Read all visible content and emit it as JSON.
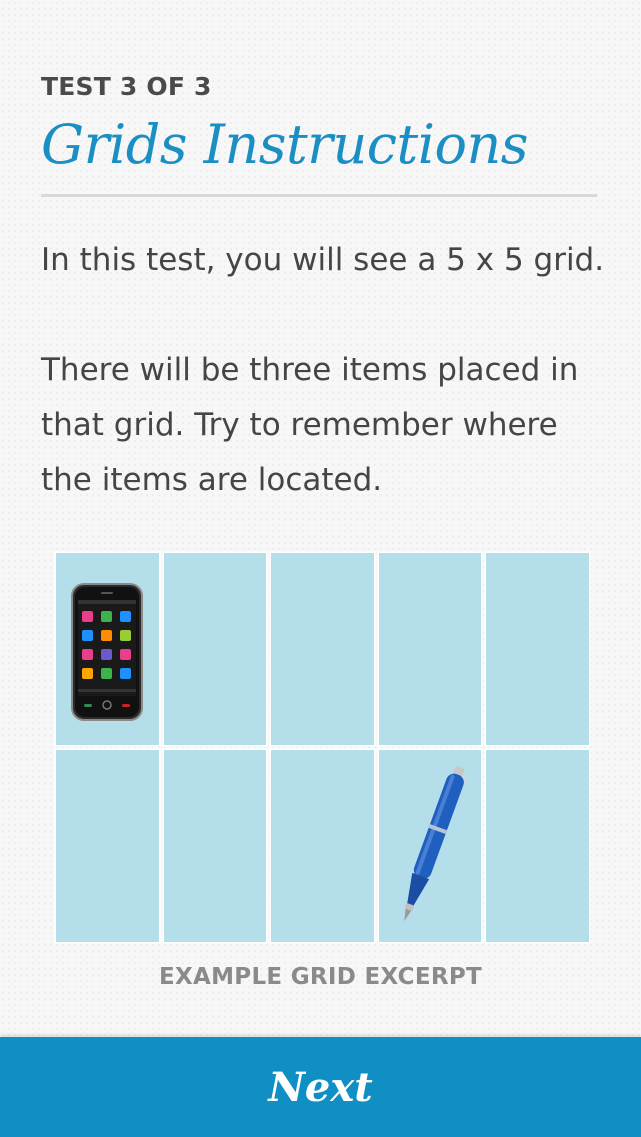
{
  "header": {
    "eyebrow": "TEST 3 OF 3",
    "title": "Grids Instructions"
  },
  "instructions": {
    "paragraph1": "In this test, you will see a 5 x 5 grid.",
    "paragraph2": "There will be three items placed in that grid. Try to remember where the items are located."
  },
  "example_grid": {
    "columns": 5,
    "rows": 2,
    "items": [
      {
        "icon": "smartphone-icon",
        "row": 1,
        "column": 1
      },
      {
        "icon": "pen-icon",
        "row": 2,
        "column": 4
      }
    ],
    "caption": "EXAMPLE GRID EXCERPT"
  },
  "footer": {
    "next_label": "Next"
  },
  "colors": {
    "accent": "#1b8fc4",
    "footer": "#0f8fc3",
    "grid_cell": "#b5deeb",
    "body_text": "#454545"
  }
}
